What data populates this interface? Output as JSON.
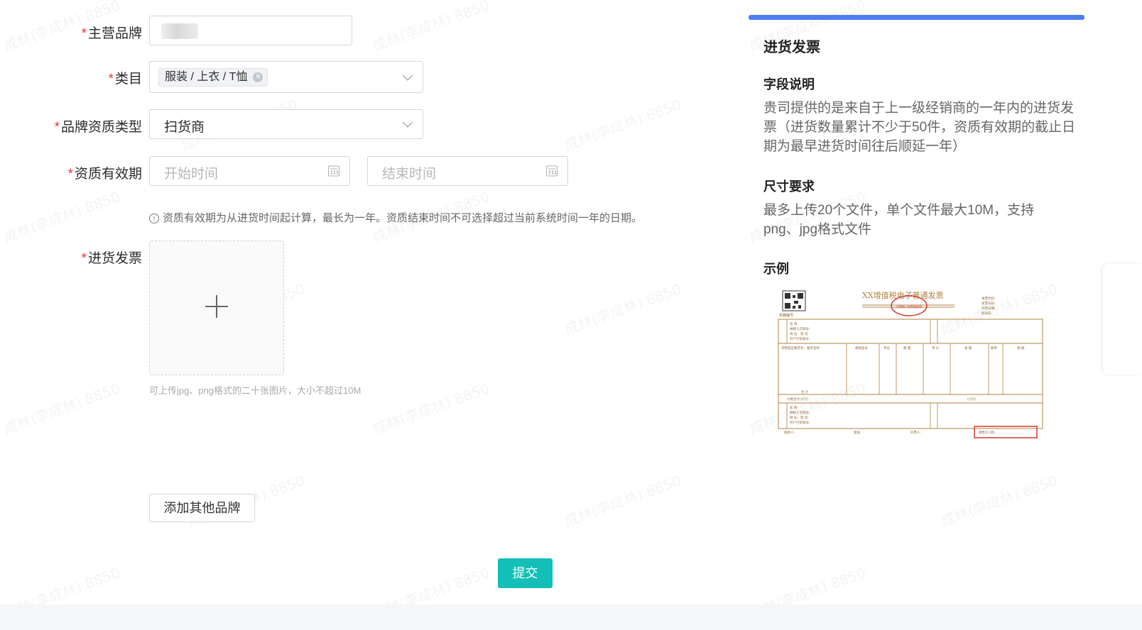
{
  "form": {
    "brand": {
      "label": "主营品牌"
    },
    "category": {
      "label": "类目",
      "tag": "服装 / 上衣 / T恤"
    },
    "qualification_type": {
      "label": "品牌资质类型",
      "value": "扫货商"
    },
    "validity": {
      "label": "资质有效期",
      "start_placeholder": "开始时间",
      "end_placeholder": "结束时间",
      "hint": "资质有效期为从进货时间起计算，最长为一年。资质结束时间不可选择超过当前系统时间一年的日期。"
    },
    "invoice": {
      "label": "进货发票",
      "upload_hint": "可上传jpg、png格式的二十张图片，大小不超过10M"
    },
    "add_brand_button": "添加其他品牌",
    "submit_button": "提交"
  },
  "side_panel": {
    "title": "进货发票",
    "field_heading": "字段说明",
    "field_text": "贵司提供的是来自于上一级经销商的一年内的进货发票（进货数量累计不少于50件，资质有效期的截止日期为最早进货时间往后顺延一年）",
    "size_heading": "尺寸要求",
    "size_text": "最多上传20个文件，单个文件最大10M，支持png、jpg格式文件",
    "example_heading": "示例",
    "example_invoice_title": "XX增值税电子普通发票"
  },
  "watermark_text": "成林(李成林) 8850",
  "colors": {
    "accent_blue": "#4d7ef0",
    "submit_teal": "#13bfb6",
    "required_red": "#e53935",
    "invoice_red": "#d33a2c",
    "invoice_brown": "#b08040"
  },
  "icons": [
    "calendar-icon",
    "chevron-down-icon",
    "info-icon",
    "plus-icon",
    "close-circle-icon",
    "qr-code-icon"
  ]
}
